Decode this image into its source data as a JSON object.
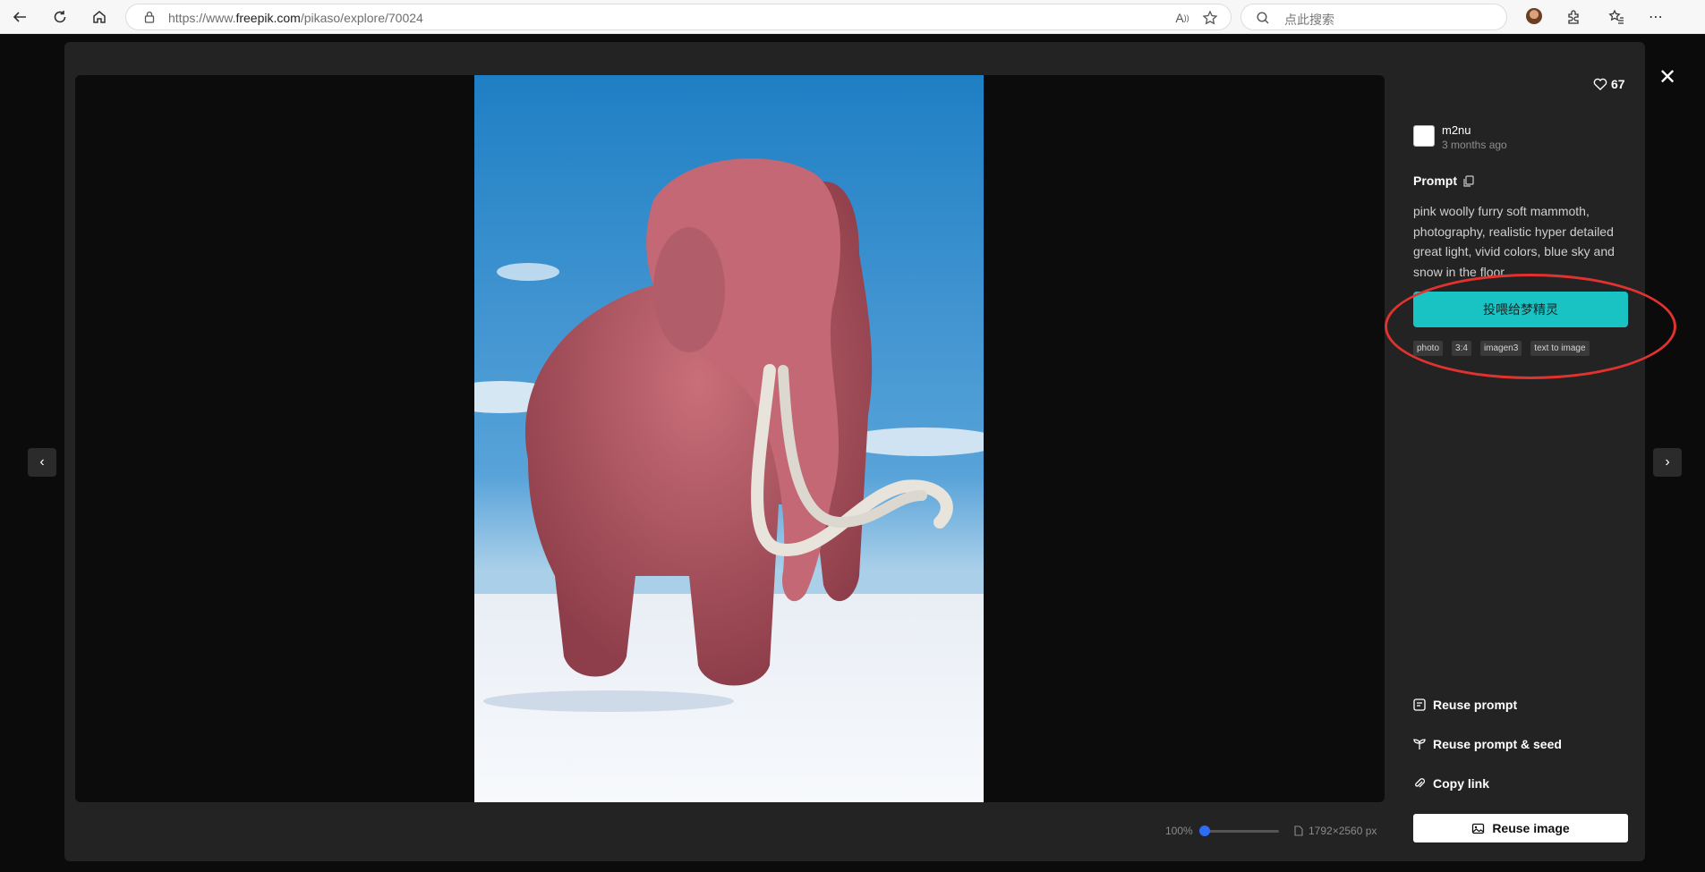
{
  "browser": {
    "url_prefix": "https://www.",
    "url_domain": "freepik.com",
    "url_path": "/pikaso/explore/70024",
    "search_placeholder": "点此搜索"
  },
  "panel": {
    "likes": "67",
    "author": "m2nu",
    "time": "3 months ago",
    "prompt_title": "Prompt",
    "prompt_text": "pink woolly furry soft mammoth, photography, realistic hyper detailed great light, vivid colors, blue sky and snow in the floor",
    "primary_button": "投喂给梦精灵",
    "tags": [
      "photo",
      "3:4",
      "imagen3",
      "text to image"
    ],
    "actions": {
      "reuse_prompt": "Reuse prompt",
      "reuse_prompt_seed": "Reuse prompt & seed",
      "copy_link": "Copy link",
      "reuse_image": "Reuse image"
    }
  },
  "viewer": {
    "zoom": "100%",
    "zoom_level": 0.0,
    "dimensions": "1792×2560 px"
  },
  "colors": {
    "accent": "#19c3c3",
    "highlight": "#e0322f",
    "slider": "#2d6df6"
  }
}
